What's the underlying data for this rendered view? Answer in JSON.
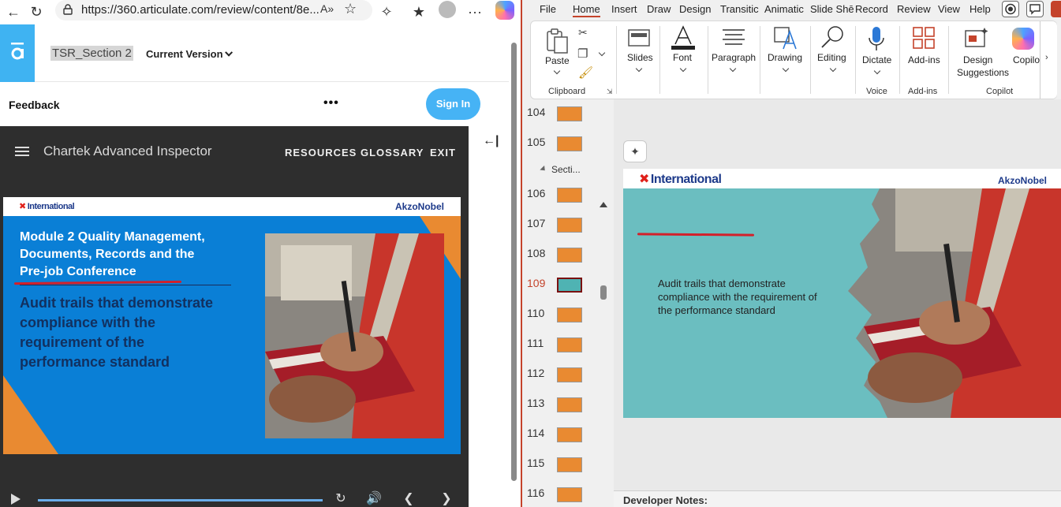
{
  "browser": {
    "url": "https://360.articulate.com/review/content/8e...",
    "read_aloud_label": "A»",
    "more_label": "···"
  },
  "review": {
    "project_name": "TSR_Section 2",
    "version_label": "Current Version",
    "feedback_title": "Feedback",
    "more_dots": "•••",
    "signin_label": "Sign In",
    "collapse_label": "←|"
  },
  "player": {
    "course_title": "Chartek Advanced Inspector",
    "nav": [
      "RESOURCES",
      "GLOSSARY",
      "EXIT"
    ],
    "progress": 1.0
  },
  "slide_left": {
    "brand_left": "International",
    "brand_right": "AkzoNobel",
    "heading_lines": [
      "Module 2 Quality Management,",
      "Documents, Records and the",
      "Pre-job Conference"
    ],
    "body_lines": [
      "Audit trails that demonstrate",
      "compliance with the",
      "requirement of the",
      "performance standard"
    ]
  },
  "ppt": {
    "menu": [
      "File",
      "Home",
      "Insert",
      "Draw",
      "Design",
      "Transitic",
      "Animatic",
      "Slide Shē",
      "Record",
      "Review",
      "View",
      "Help"
    ],
    "active_menu": "Home",
    "ribbon": {
      "paste": "Paste",
      "clipboard": "Clipboard",
      "slides": "Slides",
      "font": "Font",
      "paragraph": "Paragraph",
      "drawing": "Drawing",
      "editing": "Editing",
      "dictate": "Dictate",
      "voice": "Voice",
      "addins": "Add-ins",
      "addins_group": "Add-ins",
      "design_line1": "Design",
      "design_line2": "Suggestions",
      "copilot": "Copilo",
      "copilot_group": "Copilot"
    },
    "section_label": "Secti...",
    "slides": [
      {
        "num": "104",
        "selected": false
      },
      {
        "num": "105",
        "selected": false
      },
      {
        "num": "106",
        "selected": false
      },
      {
        "num": "107",
        "selected": false
      },
      {
        "num": "108",
        "selected": false
      },
      {
        "num": "109",
        "selected": true
      },
      {
        "num": "110",
        "selected": false
      },
      {
        "num": "111",
        "selected": false
      },
      {
        "num": "112",
        "selected": false
      },
      {
        "num": "113",
        "selected": false
      },
      {
        "num": "114",
        "selected": false
      },
      {
        "num": "115",
        "selected": false
      },
      {
        "num": "116",
        "selected": false
      }
    ],
    "slide": {
      "brand_left": "International",
      "brand_right": "AkzoNobel",
      "body_lines": [
        "Audit trails that demonstrate",
        "compliance with the requirement of",
        "the performance standard"
      ]
    },
    "developer_notes": "Developer Notes:"
  },
  "colors": {
    "articulate_blue": "#3fb3f2",
    "slide_blue": "#0a7fd6",
    "slide_orange": "#e98a31",
    "slide_teal": "#6bbec0",
    "ppt_accent": "#c4432b",
    "brand_navy": "#1d3a8a",
    "brand_red": "#e0201a",
    "annotation_red": "#d3202a"
  }
}
